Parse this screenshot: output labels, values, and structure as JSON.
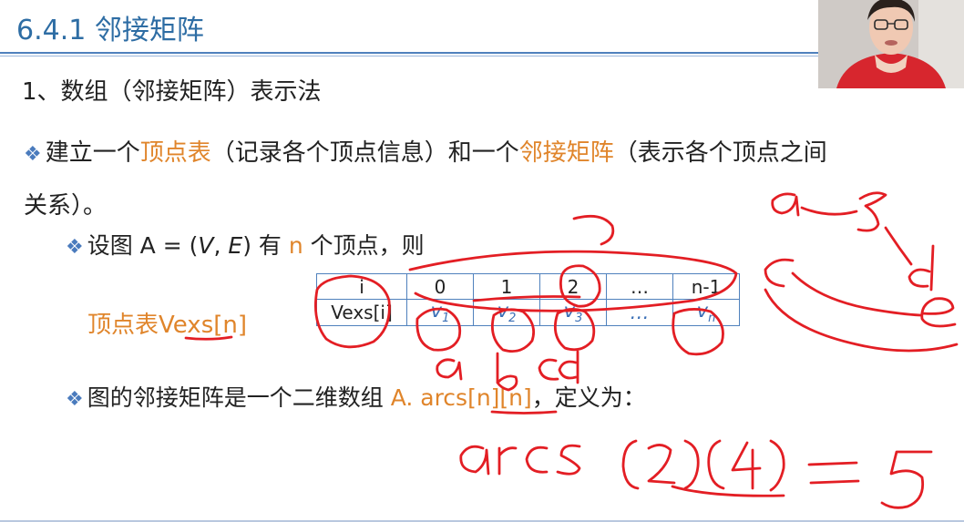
{
  "slide": {
    "title": "6.4.1 邻接矩阵",
    "heading": "1、数组（邻接矩阵）表示法",
    "bullet_symbol": "❖",
    "bullet1": {
      "text1": "建立一个",
      "highlight1": "顶点表",
      "text2": "（记录各个顶点信息）和一个",
      "highlight2": "邻接矩阵",
      "text3": "（表示各个顶点之间关系）。"
    },
    "bullet2": {
      "text1": "设图 A = (",
      "v": "V",
      "comma": ", ",
      "e": "E",
      "text2": ") 有 ",
      "n": "n",
      "text3": " 个顶点，则"
    },
    "vertex_table": {
      "label": "顶点表Vexs[n]",
      "header": [
        "i",
        "0",
        "1",
        "2",
        "…",
        "n-1"
      ],
      "row_label": "Vexs[i]",
      "row": [
        "v1",
        "v2",
        "v3",
        "…",
        "vn"
      ]
    },
    "bullet3": {
      "text1": "图的邻接矩阵是一个二维数组 ",
      "highlight": "A. arcs[n][n]",
      "text2": "，定义为："
    }
  },
  "handwriting": {
    "color": "#e31e24",
    "texts": [
      "a",
      "b",
      "c",
      "a",
      "b",
      "c",
      "d",
      "e",
      "arcs",
      "[2][4] = 5"
    ]
  },
  "video": {
    "icon": "presenter-webcam-icon"
  }
}
